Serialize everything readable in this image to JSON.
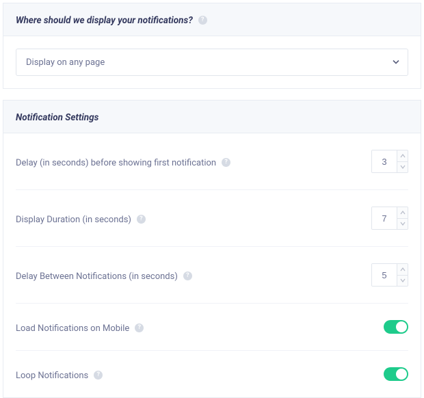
{
  "section1": {
    "title": "Where should we display your notifications?",
    "select": {
      "value": "Display on any page"
    }
  },
  "section2": {
    "title": "Notification Settings",
    "settings": {
      "delay_first": {
        "label": "Delay (in seconds) before showing first notification",
        "value": "3"
      },
      "display_duration": {
        "label": "Display Duration (in seconds)",
        "value": "7"
      },
      "delay_between": {
        "label": "Delay Between Notifications (in seconds)",
        "value": "5"
      },
      "load_mobile": {
        "label": "Load Notifications on Mobile",
        "enabled": true
      },
      "loop": {
        "label": "Loop Notifications",
        "enabled": true
      }
    }
  },
  "icons": {
    "help": "?"
  },
  "colors": {
    "toggle_on": "#1ecb8b"
  }
}
